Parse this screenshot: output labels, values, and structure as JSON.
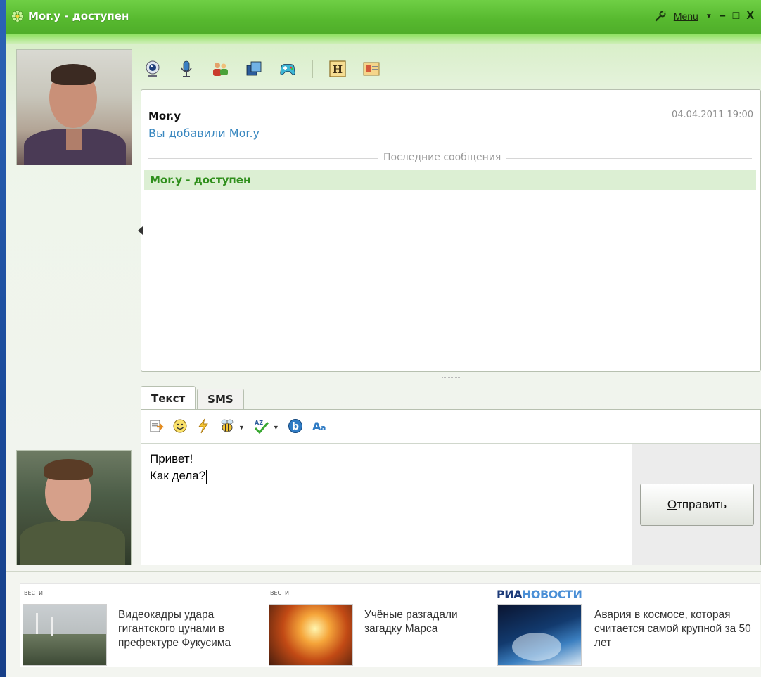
{
  "window": {
    "title": "Mor.y - доступен",
    "menu_label": "Menu",
    "controls": [
      "–",
      "□",
      "X"
    ]
  },
  "toolbar_icons": [
    "webcam-icon",
    "microphone-icon",
    "contacts-icon",
    "screens-icon",
    "gamepad-icon",
    "history-icon",
    "contact-card-icon"
  ],
  "conversation": {
    "sender": "Mor.y",
    "timestamp": "04.04.2011 19:00",
    "system_message": "Вы добавили Mor.y",
    "divider_label": "Последние сообщения",
    "status_message": "Mor.y - доступен"
  },
  "tabs": [
    {
      "label": "Текст",
      "active": true
    },
    {
      "label": "SMS",
      "active": false
    }
  ],
  "compose_icons": [
    "insert-file-icon",
    "smiley-icon",
    "lightning-icon",
    "bee-icon",
    "spellcheck-icon",
    "bold-icon",
    "font-icon"
  ],
  "compose": {
    "line1": "Привет!",
    "line2": "Как дела?",
    "send_label_mnemonic": "О",
    "send_label_rest": "тправить"
  },
  "news": [
    {
      "source": "ВЕСТИ",
      "text": "Видеокадры удара гигантского цунами в префектуре Фукусима",
      "linked": true
    },
    {
      "source": "ВЕСТИ",
      "text": "Учёные разгадали загадку Марса",
      "linked": false
    },
    {
      "source_part1": "РИА",
      "source_part2": "НОВОСТИ",
      "text": "Авария в космосе, которая считается самой крупной за 50 лет",
      "linked": true
    }
  ],
  "colors": {
    "title_bar": "#57b92f",
    "status_green": "#2f8f1c",
    "system_blue": "#3a88c0",
    "ria_red": "#1f3c7a"
  }
}
